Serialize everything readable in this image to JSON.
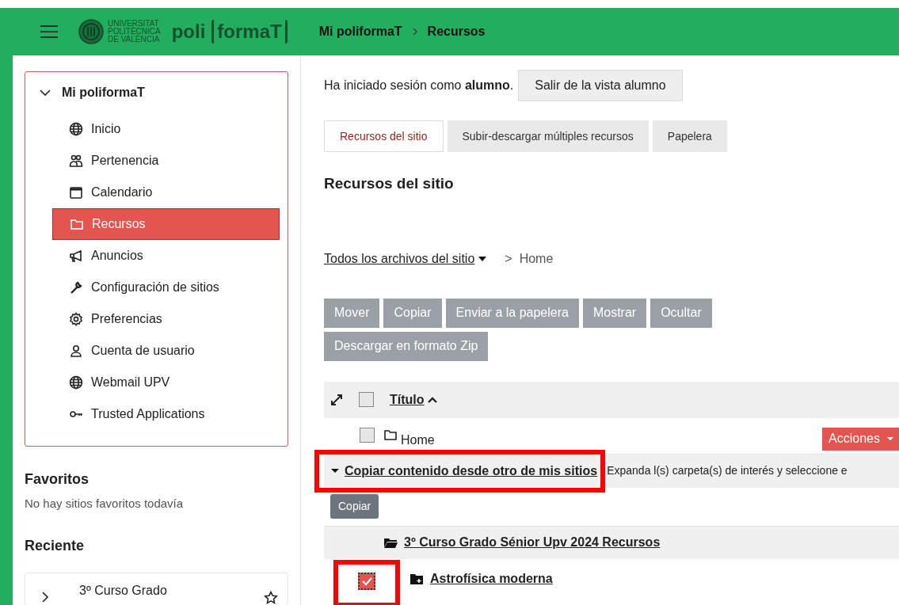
{
  "header": {
    "logo_lines": [
      "UNIVERSITAT",
      "POLITÈCNICA",
      "DE VALÈNCIA"
    ],
    "brand_prefix": "poli",
    "brand_name": "formaT",
    "breadcrumb": [
      "Mi poliformaT",
      "Recursos"
    ]
  },
  "sidebar": {
    "section_title": "Mi poliformaT",
    "expanded": true,
    "items": [
      {
        "label": "Inicio",
        "selected": false
      },
      {
        "label": "Pertenencia",
        "selected": false
      },
      {
        "label": "Calendario",
        "selected": false
      },
      {
        "label": "Recursos",
        "selected": true
      },
      {
        "label": "Anuncios",
        "selected": false
      },
      {
        "label": "Configuración de sitios",
        "selected": false
      },
      {
        "label": "Preferencias",
        "selected": false
      },
      {
        "label": "Cuenta de usuario",
        "selected": false
      },
      {
        "label": "Webmail UPV",
        "selected": false
      },
      {
        "label": "Trusted Applications",
        "selected": false
      }
    ],
    "favorites": {
      "title": "Favoritos",
      "empty_text": "No hay sitios favoritos todavía"
    },
    "recent": {
      "title": "Reciente",
      "items": [
        {
          "label": "3º Curso Grado"
        }
      ]
    }
  },
  "main": {
    "notice": "Ha iniciado sesión como **alumno**.",
    "exit_button": "Salir de la vista alumno",
    "tabs": [
      {
        "label": "Recursos del sitio",
        "selected": true
      },
      {
        "label": "Subir-descargar múltiples recursos",
        "selected": false
      },
      {
        "label": "Papelera",
        "selected": false
      }
    ],
    "heading": "Recursos del sitio",
    "path": {
      "dropdown": "Todos los archivos del sitio",
      "separator": ">",
      "current": "Home"
    },
    "actions": [
      "Mover",
      "Copiar",
      "Enviar a la papelera",
      "Mostrar",
      "Ocultar",
      "Descargar en formato Zip"
    ],
    "table": {
      "all_checked": false,
      "column": "Título",
      "rows": [
        {
          "label": "Home",
          "checked": false,
          "menu_button": "Acciones"
        }
      ]
    },
    "copy_section": {
      "expanded": true,
      "title": "Copiar contenido desde otro de mis sitios",
      "description": "Expanda l(s) carpeta(s) de interés y seleccione e",
      "button": "Copiar",
      "site": "3º Curso Grado Sénior Upv 2024 Recursos",
      "folders": [
        {
          "label": "Astrofísica moderna",
          "checked": true
        }
      ]
    }
  }
}
